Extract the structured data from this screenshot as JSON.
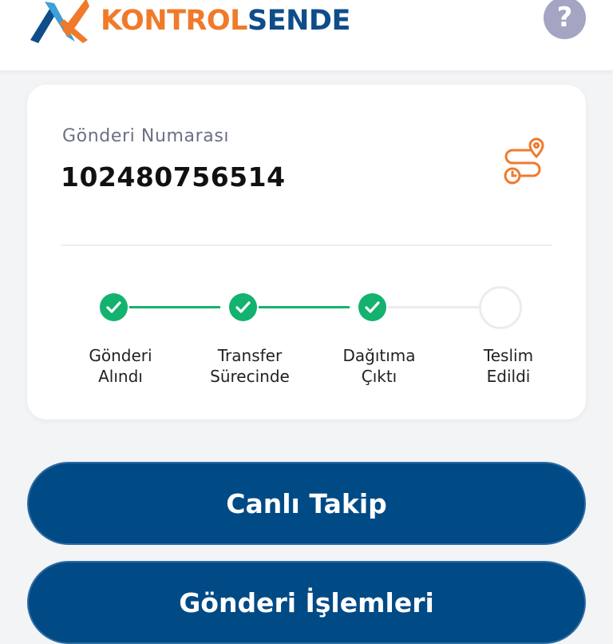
{
  "header": {
    "brand_part1": "KONTROL",
    "brand_part2": "SENDE",
    "help_symbol": "?",
    "help_icon": "question-mark-icon",
    "colors": {
      "orange": "#f07a2a",
      "blue": "#0f4d8a",
      "help": "#a3a5c2"
    }
  },
  "shipment": {
    "label": "Gönderi Numarası",
    "number": "102480756514",
    "route_icon": "route-map-pin-icon"
  },
  "steps": [
    {
      "line1": "Gönderi",
      "line2": "Alındı",
      "status": "done"
    },
    {
      "line1": "Transfer",
      "line2": "Sürecinde",
      "status": "done"
    },
    {
      "line1": "Dağıtıma",
      "line2": "Çıktı",
      "status": "done"
    },
    {
      "line1": "Teslim",
      "line2": "Edildi",
      "status": "pending"
    }
  ],
  "colors": {
    "done": "#14b26f",
    "pending_line": "#ececec",
    "button": "#004a86"
  },
  "buttons": {
    "live_tracking": "Canlı Takip",
    "shipment_actions": "Gönderi İşlemleri"
  }
}
